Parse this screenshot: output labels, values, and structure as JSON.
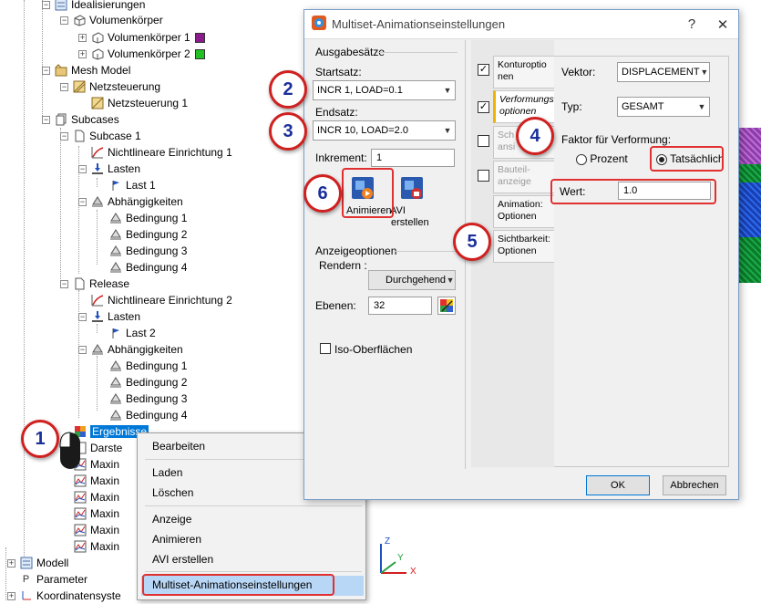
{
  "tree": {
    "items": [
      {
        "label": "Idealisierungen"
      },
      {
        "label": "Volumenkörper"
      },
      {
        "label": "Volumenkörper 1",
        "swatch": "#8b1a8b"
      },
      {
        "label": "Volumenkörper 2",
        "swatch": "#22c022"
      },
      {
        "label": "Mesh Model"
      },
      {
        "label": "Netzsteuerung"
      },
      {
        "label": "Netzsteuerung 1"
      },
      {
        "label": "Subcases"
      },
      {
        "label": "Subcase 1"
      },
      {
        "label": "Nichtlineare Einrichtung 1"
      },
      {
        "label": "Lasten"
      },
      {
        "label": "Last 1"
      },
      {
        "label": "Abhängigkeiten"
      },
      {
        "label": "Bedingung 1"
      },
      {
        "label": "Bedingung 2"
      },
      {
        "label": "Bedingung 3"
      },
      {
        "label": "Bedingung 4"
      },
      {
        "label": "Release"
      },
      {
        "label": "Nichtlineare Einrichtung 2"
      },
      {
        "label": "Lasten"
      },
      {
        "label": "Last 2"
      },
      {
        "label": "Abhängigkeiten"
      },
      {
        "label": "Bedingung 1"
      },
      {
        "label": "Bedingung 2"
      },
      {
        "label": "Bedingung 3"
      },
      {
        "label": "Bedingung 4"
      },
      {
        "label": "Ergebnisse"
      },
      {
        "label": "Darste"
      },
      {
        "label": "Maxin"
      },
      {
        "label": "Maxin"
      },
      {
        "label": "Maxin"
      },
      {
        "label": "Maxin"
      },
      {
        "label": "Maxin"
      },
      {
        "label": "Maxin"
      },
      {
        "label": "Modell"
      },
      {
        "label": "Parameter"
      },
      {
        "label": "Koordinatensyste"
      }
    ]
  },
  "context_menu": {
    "items": [
      "Bearbeiten",
      "Laden",
      "Löschen",
      "Anzeige",
      "Animieren",
      "AVI erstellen",
      "Multiset-Animationseinstellungen"
    ]
  },
  "dialog": {
    "title": "Multiset-Animationseinstellungen",
    "help": "?",
    "close": "✕",
    "ausgabesaetze": {
      "title": "Ausgabesätze",
      "startsatz_label": "Startsatz:",
      "startsatz_value": "INCR 1, LOAD=0.1",
      "endsatz_label": "Endsatz:",
      "endsatz_value": "INCR 10, LOAD=2.0",
      "inkrement_label": "Inkrement:",
      "inkrement_value": "1",
      "animieren_label": "Animieren",
      "avi_label_1": "AVI",
      "avi_label_2": "erstellen"
    },
    "anzeigeoptionen": {
      "title": "Anzeigeoptionen",
      "rendern_label": "Rendern :",
      "rendern_value": "Durchgehend",
      "ebenen_label": "Ebenen:",
      "ebenen_value": "32",
      "iso_label": "Iso-Oberflächen"
    },
    "tabs": [
      {
        "line1": "Konturoptio",
        "line2": "nen",
        "checked": true
      },
      {
        "line1": "Verformungs",
        "line2": "optionen",
        "checked": true
      },
      {
        "line1": "Sch",
        "line2": "ansi",
        "checked": false
      },
      {
        "line1": "Bauteil-",
        "line2": "anzeige",
        "checked": false
      },
      {
        "line1": "Animation:",
        "line2": "Optionen"
      },
      {
        "line1": "Sichtbarkeit:",
        "line2": "Optionen"
      }
    ],
    "right": {
      "vektor_label": "Vektor:",
      "vektor_value": "DISPLACEMENT",
      "typ_label": "Typ:",
      "typ_value": "GESAMT",
      "faktor_label": "Faktor für Verformung:",
      "prozent_label": "Prozent",
      "tatsaechlich_label": "Tatsächlich",
      "wert_label": "Wert:",
      "wert_value": "1.0"
    },
    "ok_label": "OK",
    "abbrechen_label": "Abbrechen"
  },
  "callouts": [
    "1",
    "2",
    "3",
    "4",
    "5",
    "6"
  ],
  "triad": {
    "x": "X",
    "y": "Y",
    "z": "Z"
  }
}
